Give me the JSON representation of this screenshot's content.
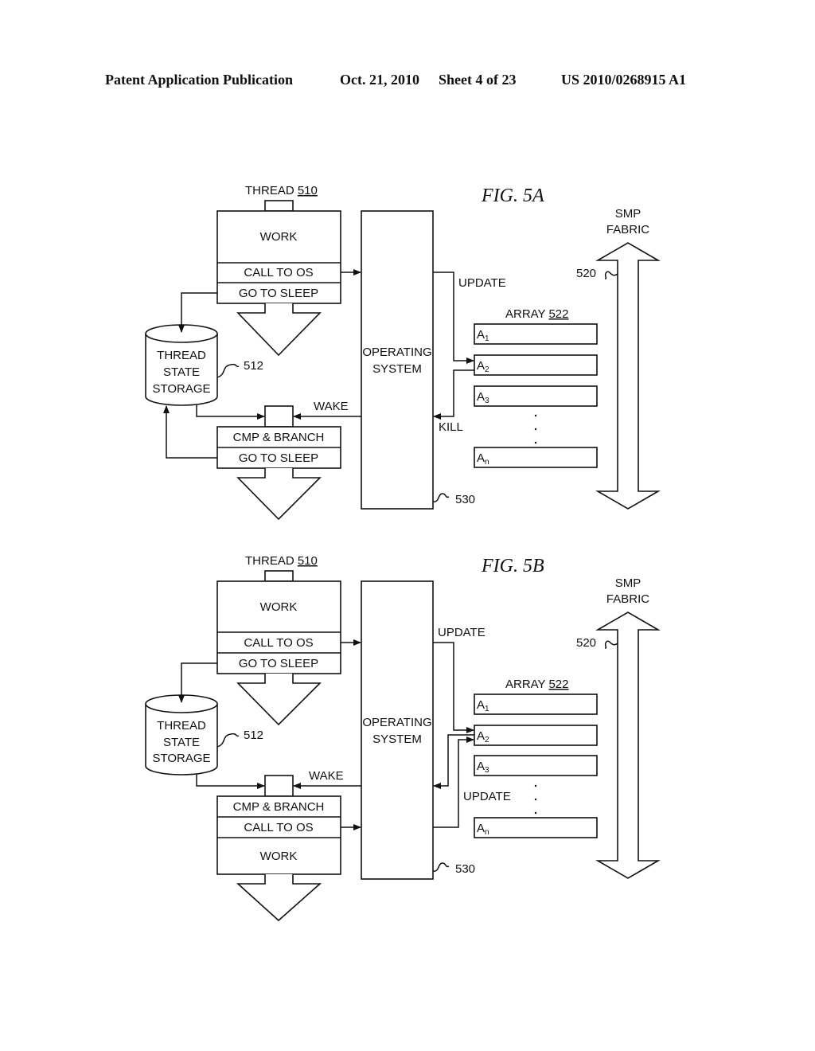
{
  "header": {
    "publication": "Patent Application Publication",
    "date": "Oct. 21, 2010",
    "sheet": "Sheet 4 of 23",
    "number": "US 2010/0268915 A1"
  },
  "figures": [
    {
      "title": "FIG. 5A",
      "thread_label": "THREAD",
      "thread_ref": "510",
      "upper_block": [
        "WORK",
        "CALL TO OS",
        "GO TO SLEEP"
      ],
      "storage": [
        "THREAD",
        "STATE",
        "STORAGE"
      ],
      "storage_ref": "512",
      "lower_block": [
        "CMP & BRANCH",
        "GO TO SLEEP"
      ],
      "os": [
        "OPERATING",
        "SYSTEM"
      ],
      "os_ref": "530",
      "wake_label": "WAKE",
      "update_label": "UPDATE",
      "return_label": "KILL",
      "array_label": "ARRAY",
      "array_ref": "522",
      "array_items": [
        {
          "base": "A",
          "sub": "1"
        },
        {
          "base": "A",
          "sub": "2"
        },
        {
          "base": "A",
          "sub": "3"
        },
        {
          "base": "A",
          "sub": "n"
        }
      ],
      "fabric": [
        "SMP",
        "FABRIC"
      ],
      "fabric_ref": "520"
    },
    {
      "title": "FIG. 5B",
      "thread_label": "THREAD",
      "thread_ref": "510",
      "upper_block": [
        "WORK",
        "CALL TO OS",
        "GO TO SLEEP"
      ],
      "storage": [
        "THREAD",
        "STATE",
        "STORAGE"
      ],
      "storage_ref": "512",
      "lower_block": [
        "CMP & BRANCH",
        "CALL TO OS",
        "WORK"
      ],
      "os": [
        "OPERATING",
        "SYSTEM"
      ],
      "os_ref": "530",
      "wake_label": "WAKE",
      "update_label": "UPDATE",
      "update2_label": "UPDATE",
      "array_label": "ARRAY",
      "array_ref": "522",
      "array_items": [
        {
          "base": "A",
          "sub": "1"
        },
        {
          "base": "A",
          "sub": "2"
        },
        {
          "base": "A",
          "sub": "3"
        },
        {
          "base": "A",
          "sub": "n"
        }
      ],
      "fabric": [
        "SMP",
        "FABRIC"
      ],
      "fabric_ref": "520"
    }
  ]
}
